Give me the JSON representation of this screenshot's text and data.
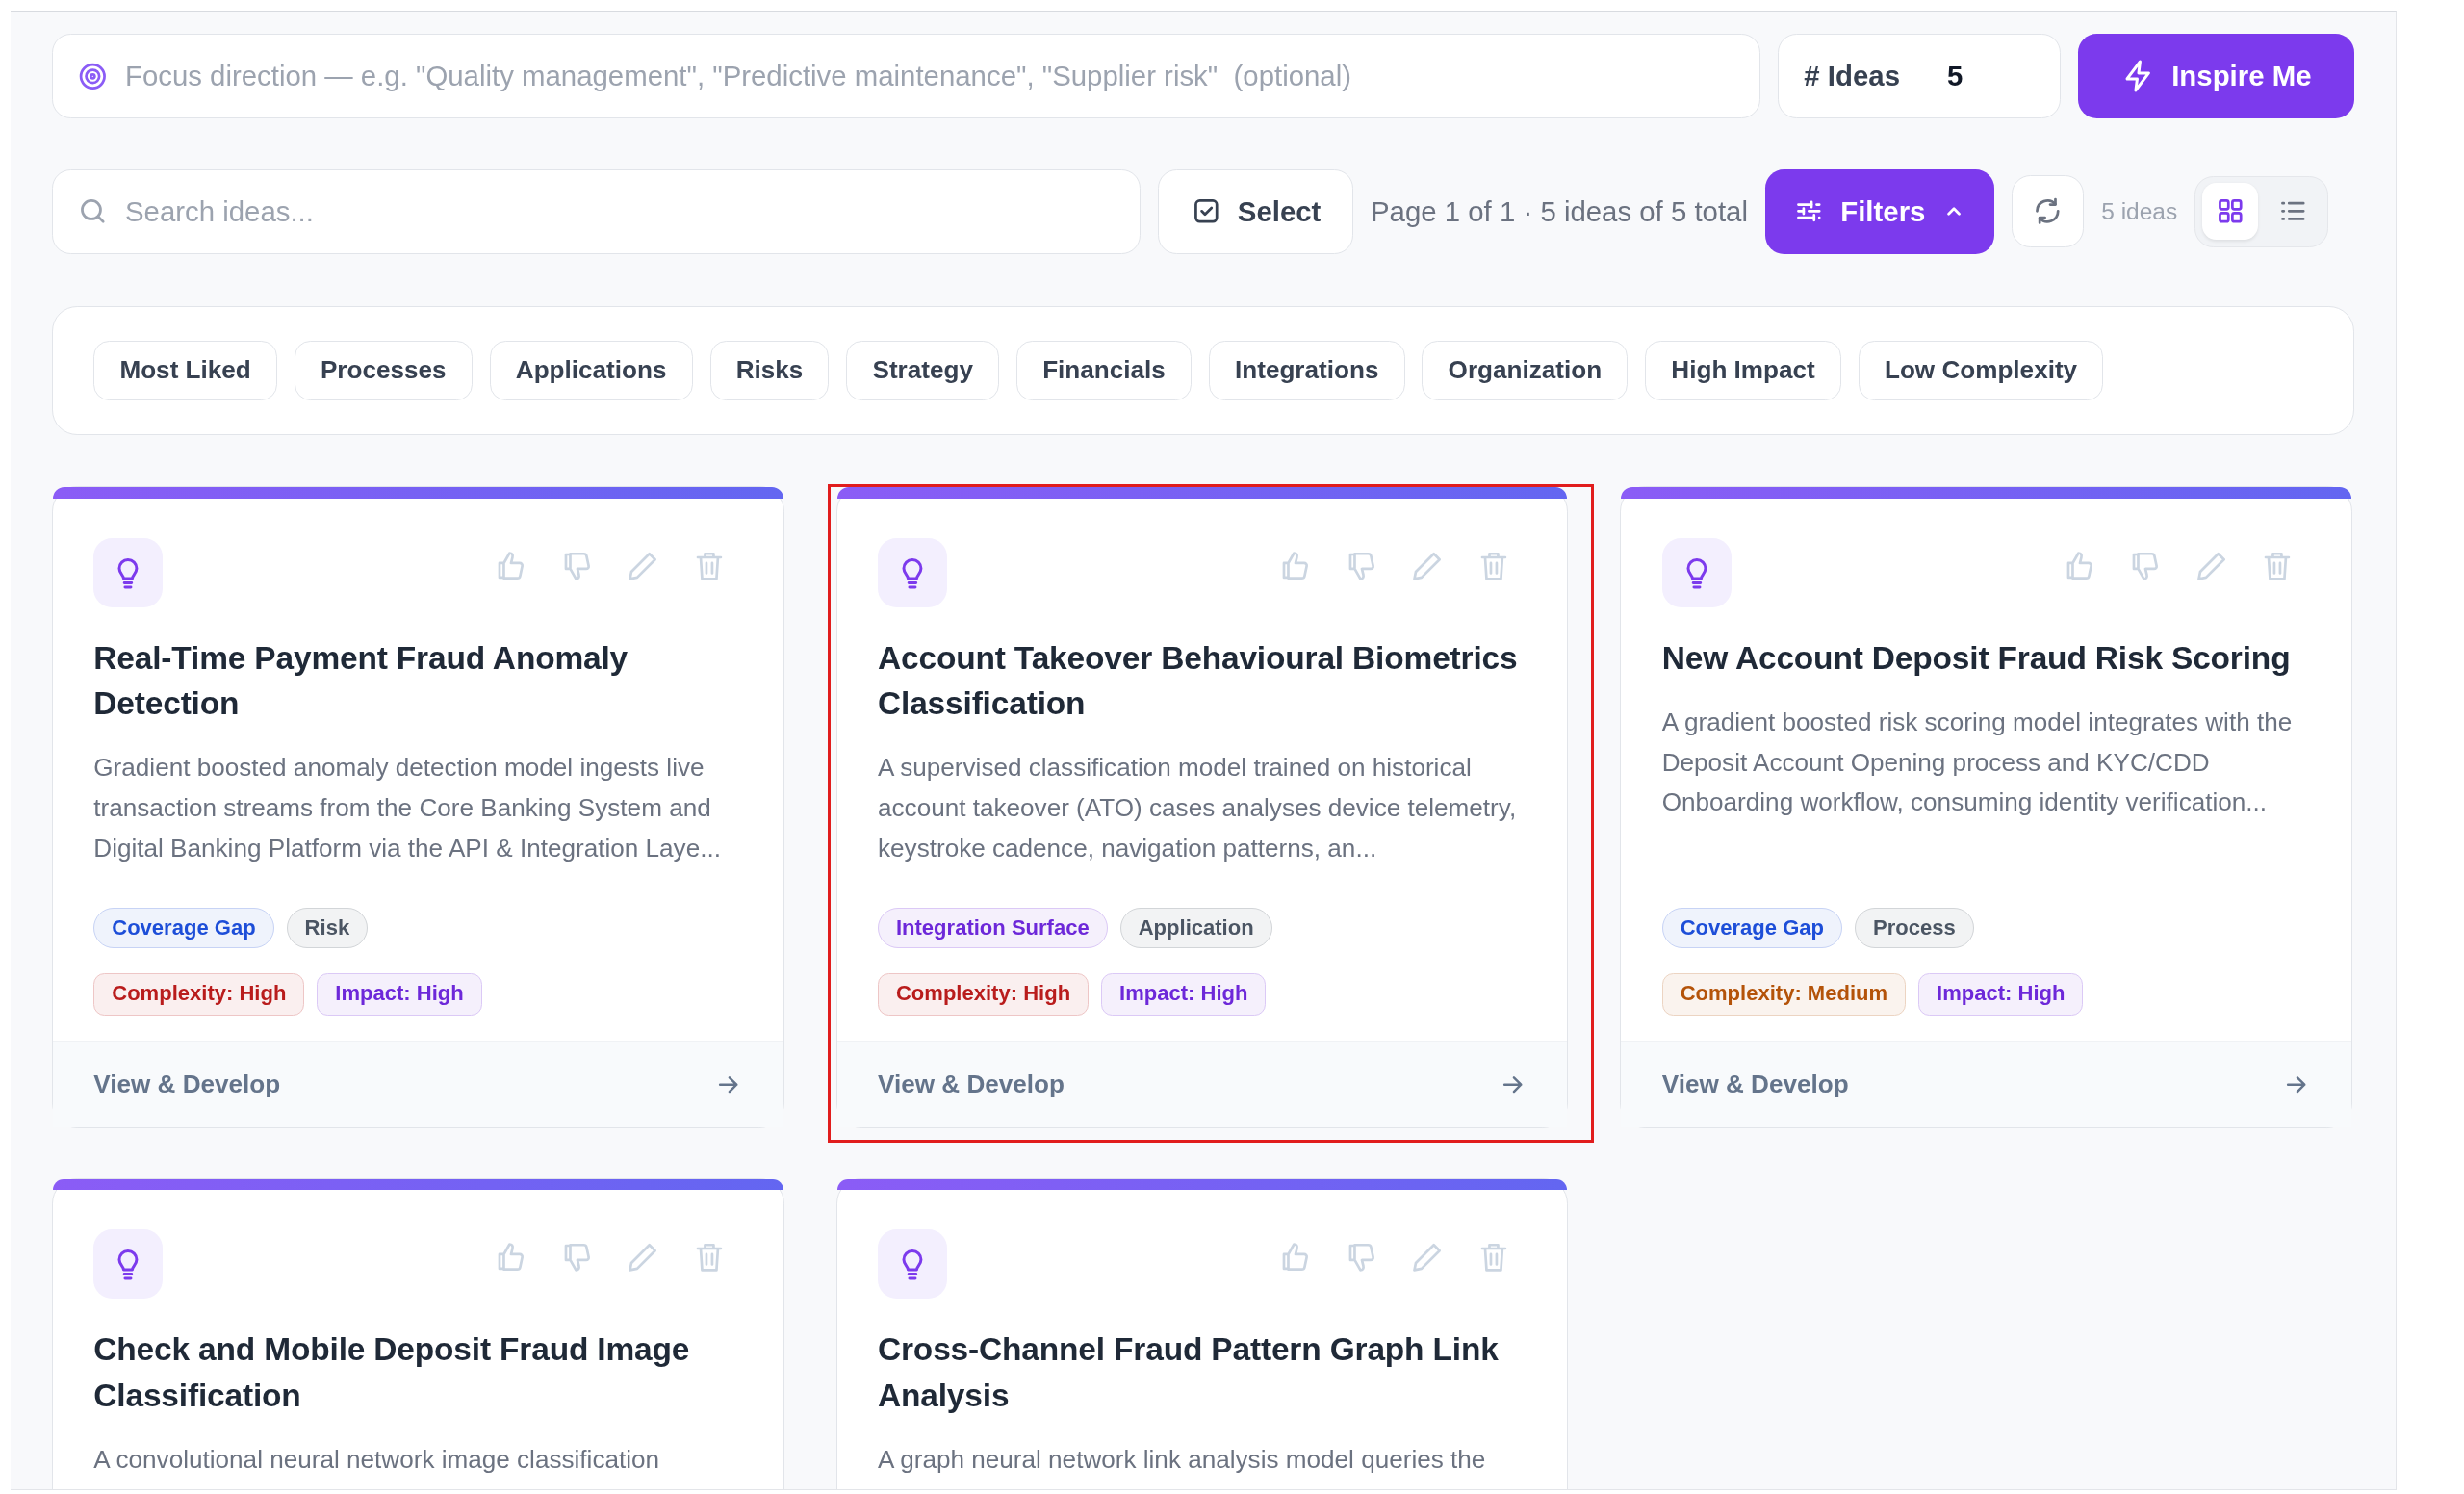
{
  "focus_field": {
    "placeholder": "Focus direction — e.g. \"Quality management\", \"Predictive maintenance\", \"Supplier risk\"  (optional)"
  },
  "ideas_field": {
    "label": "# Ideas",
    "value": "5"
  },
  "inspire_button": {
    "label": "Inspire Me"
  },
  "search_field": {
    "placeholder": "Search ideas..."
  },
  "select_button": {
    "label": "Select"
  },
  "page_info": "Page 1 of 1 · 5 ideas of 5 total",
  "filters_button": {
    "label": "Filters",
    "expanded": true
  },
  "idea_count": "5 ideas",
  "view_toggle": [
    {
      "kind": "grid",
      "selected": true
    },
    {
      "kind": "list",
      "selected": false
    }
  ],
  "filter_chips": [
    {
      "label": "Most Liked",
      "selected": false
    },
    {
      "label": "Processes",
      "selected": false
    },
    {
      "label": "Applications",
      "selected": false
    },
    {
      "label": "Risks",
      "selected": false
    },
    {
      "label": "Strategy",
      "selected": false
    },
    {
      "label": "Financials",
      "selected": false
    },
    {
      "label": "Integrations",
      "selected": false
    },
    {
      "label": "Organization",
      "selected": false
    },
    {
      "label": "High Impact",
      "selected": false
    },
    {
      "label": "Low Complexity",
      "selected": false
    }
  ],
  "cards": [
    {
      "title": "Real-Time Payment Fraud Anomaly Detection",
      "description": "Gradient boosted anomaly detection model ingests live transaction streams from the Core Banking System and Digital Banking Platform via the API & Integration Laye...",
      "tags": [
        {
          "label": "Coverage Gap",
          "color": "#1d4ed8"
        },
        {
          "label": "Risk",
          "color": "#4b5563"
        }
      ],
      "ratings": [
        {
          "label": "Complexity: High",
          "color": "#b91c1c"
        },
        {
          "label": "Impact: High",
          "color": "#6d28d9"
        }
      ],
      "footer": "View & Develop",
      "highlighted": false
    },
    {
      "title": "Account Takeover Behavioural Biometrics Classification",
      "description": "A supervised classification model trained on historical account takeover (ATO) cases analyses device telemetry, keystroke cadence, navigation patterns, an...",
      "tags": [
        {
          "label": "Integration Surface",
          "color": "#6d28d9"
        },
        {
          "label": "Application",
          "color": "#4b5563"
        }
      ],
      "ratings": [
        {
          "label": "Complexity: High",
          "color": "#b91c1c"
        },
        {
          "label": "Impact: High",
          "color": "#6d28d9"
        }
      ],
      "footer": "View & Develop",
      "highlighted": true
    },
    {
      "title": "New Account Deposit Fraud Risk Scoring",
      "description": "A gradient boosted risk scoring model integrates with the Deposit Account Opening process and KYC/CDD Onboarding workflow, consuming identity verification...",
      "tags": [
        {
          "label": "Coverage Gap",
          "color": "#1d4ed8"
        },
        {
          "label": "Process",
          "color": "#4b5563"
        }
      ],
      "ratings": [
        {
          "label": "Complexity: Medium",
          "color": "#b45309"
        },
        {
          "label": "Impact: High",
          "color": "#6d28d9"
        }
      ],
      "footer": "View & Develop",
      "highlighted": false
    },
    {
      "title": "Check and Mobile Deposit Fraud Image Classification",
      "description": "A convolutional neural network image classification",
      "highlighted": false
    },
    {
      "title": "Cross-Channel Fraud Pattern Graph Link Analysis",
      "description": "A graph neural network link analysis model queries the",
      "highlighted": false
    }
  ]
}
